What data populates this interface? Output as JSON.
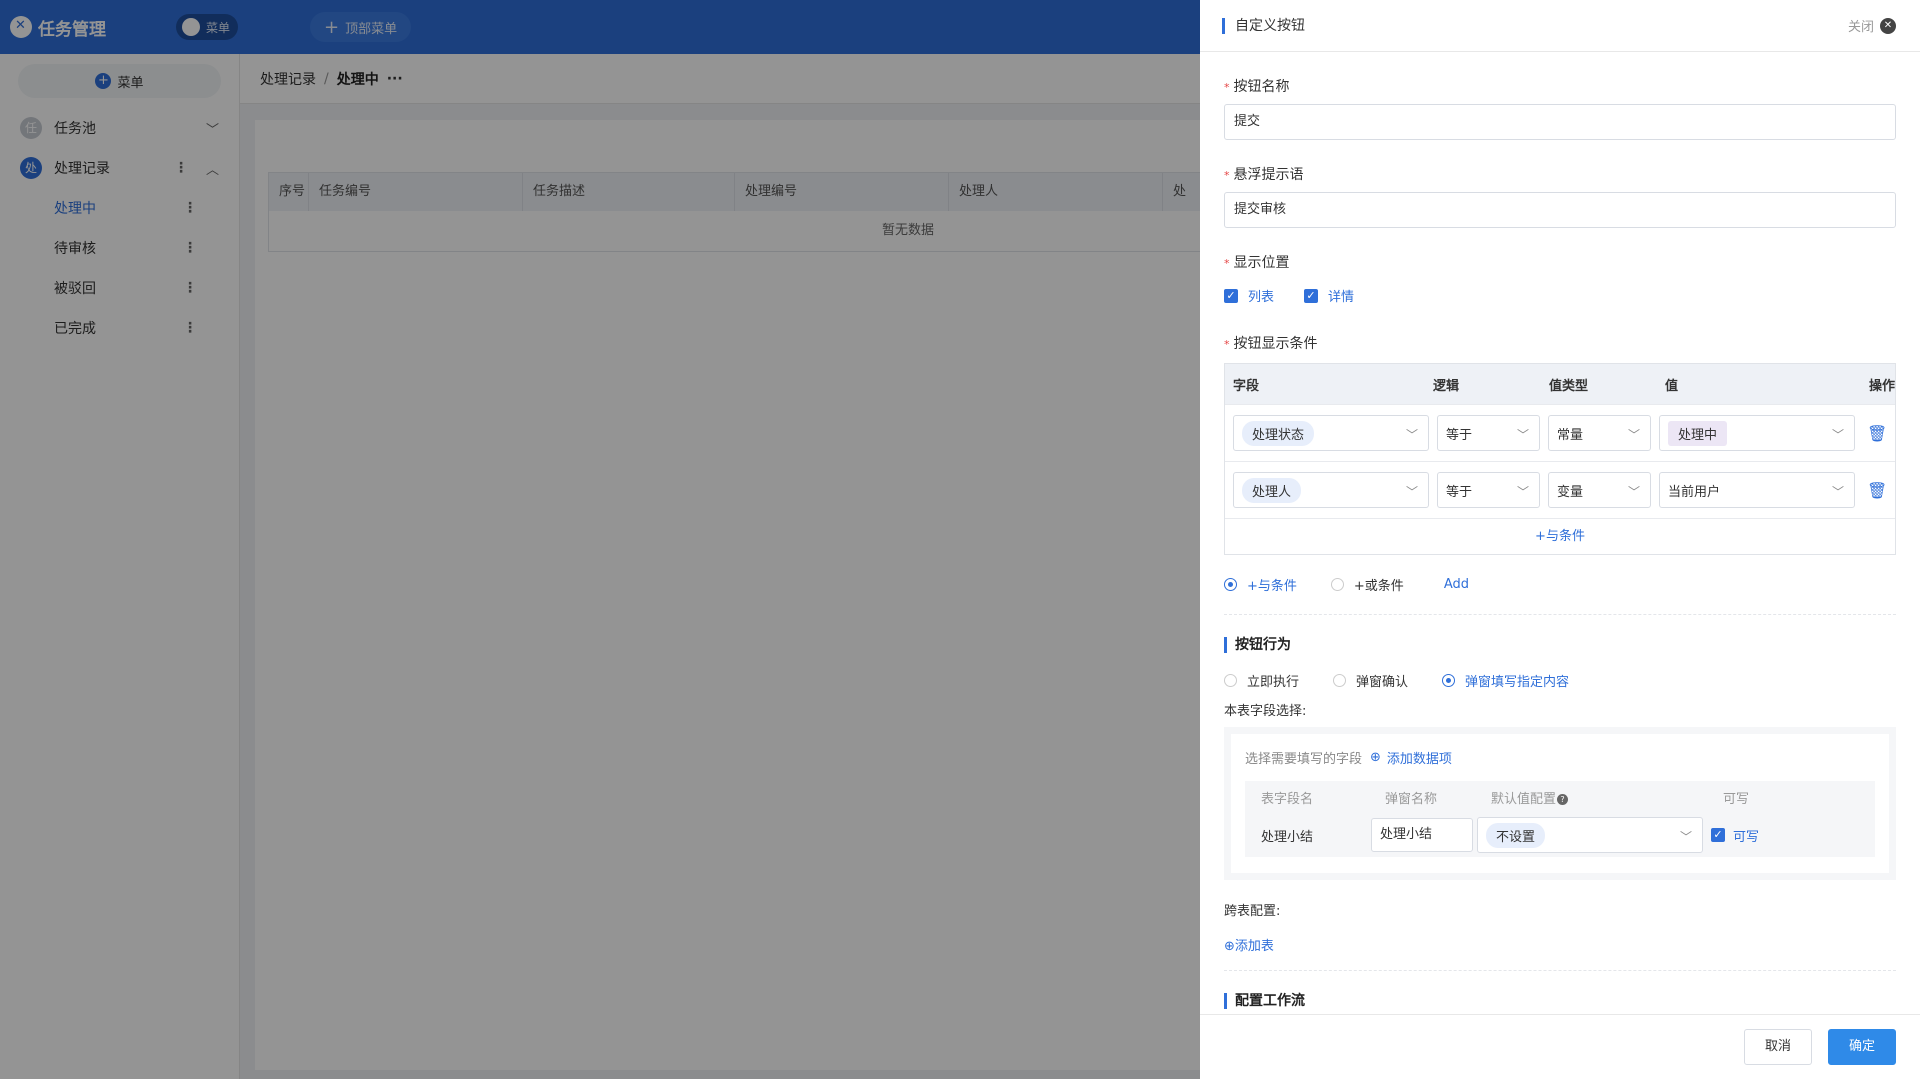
{
  "app": {
    "title": "任务管理",
    "menu_toggle_label": "菜单",
    "top_menu_button": "顶部菜单"
  },
  "sidebar": {
    "add_button": "菜单",
    "groups": [
      {
        "badge": "任",
        "label": "任务池"
      },
      {
        "badge": "处",
        "label": "处理记录"
      }
    ],
    "sub_items": [
      {
        "label": "处理中"
      },
      {
        "label": "待审核"
      },
      {
        "label": "被驳回"
      },
      {
        "label": "已完成"
      }
    ]
  },
  "breadcrumb": {
    "parent": "处理记录",
    "separator": "/",
    "current": "处理中",
    "more": "···"
  },
  "table": {
    "headers": [
      "序号",
      "任务编号",
      "任务描述",
      "处理编号",
      "处理人",
      "处"
    ],
    "empty_text": "暂无数据"
  },
  "drawer": {
    "title": "自定义按钮",
    "close_label": "关闭",
    "button_name_label": "按钮名称",
    "button_name_value": "提交",
    "tooltip_label": "悬浮提示语",
    "tooltip_value": "提交审核",
    "position_label": "显示位置",
    "position_options": [
      "列表",
      "详情"
    ],
    "condition_label": "按钮显示条件",
    "condition_headers": {
      "field": "字段",
      "logic": "逻辑",
      "value_type": "值类型",
      "value": "值",
      "action": "操作"
    },
    "condition_rows": [
      {
        "field": "处理状态",
        "logic": "等于",
        "value_type": "常量",
        "value": "处理中"
      },
      {
        "field": "处理人",
        "logic": "等于",
        "value_type": "变量",
        "value": "当前用户"
      }
    ],
    "condition_add": "+与条件",
    "relation_options": [
      "+与条件",
      "+或条件"
    ],
    "relation_add": "Add",
    "behavior_title": "按钮行为",
    "behavior_options": [
      "立即执行",
      "弹窗确认",
      "弹窗填写指定内容"
    ],
    "field_select_label": "本表字段选择:",
    "field_select_hint": "选择需要填写的字段",
    "field_add_item": "添加数据项",
    "field_headers": {
      "name": "表字段名",
      "popup_name": "弹窗名称",
      "default": "默认值配置",
      "writable": "可写"
    },
    "field_rows": [
      {
        "name": "处理小结",
        "popup_name": "处理小结",
        "default": "不设置",
        "writable": "可写"
      }
    ],
    "cross_table_label": "跨表配置:",
    "add_table": "⊕添加表",
    "workflow_title": "配置工作流",
    "cancel": "取消",
    "confirm": "确定"
  }
}
